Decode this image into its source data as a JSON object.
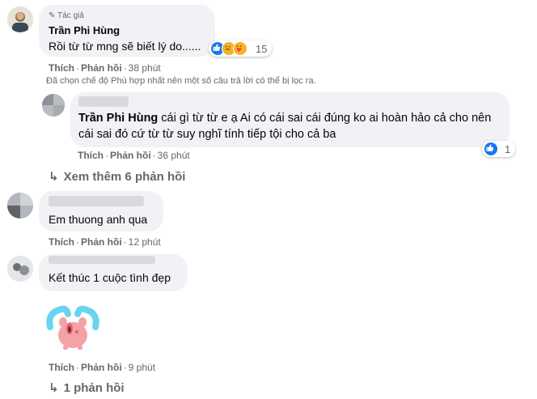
{
  "comment1": {
    "badge": "Tác giả",
    "author": "Trần Phi Hùng",
    "text": "Rồi từ từ mng sẽ biết lý do......",
    "reaction_count": "15",
    "actions": {
      "like": "Thích",
      "reply": "Phản hồi",
      "time": "38 phút"
    }
  },
  "filter_notice": "Đã chọn chế độ Phù hợp nhất nên một số câu trả lời có thể bị lọc ra.",
  "reply1": {
    "mention": "Trần Phi Hùng",
    "text": " cái gì từ từ e ạ Ai có cái sai cái đúng ko ai hoàn hảo cả cho nên cái sai đó cứ từ từ suy nghĩ tính tiếp tội cho cả ba",
    "reaction_count": "1",
    "actions": {
      "like": "Thích",
      "reply": "Phản hồi",
      "time": "36 phút"
    }
  },
  "view_more_replies": "Xem thêm 6 phản hồi",
  "comment2": {
    "text": "Em thuong anh qua",
    "actions": {
      "like": "Thích",
      "reply": "Phản hồi",
      "time": "12 phút"
    }
  },
  "comment3": {
    "text": "Kết thúc 1 cuộc tình đẹp",
    "actions": {
      "like": "Thích",
      "reply": "Phản hồi",
      "time": "9 phút"
    }
  },
  "replies_count": "1 phản hồi",
  "colors": {
    "like_blue": "#1877f2",
    "secondary_text": "#65676b",
    "bubble_bg": "#f0f2f5"
  }
}
